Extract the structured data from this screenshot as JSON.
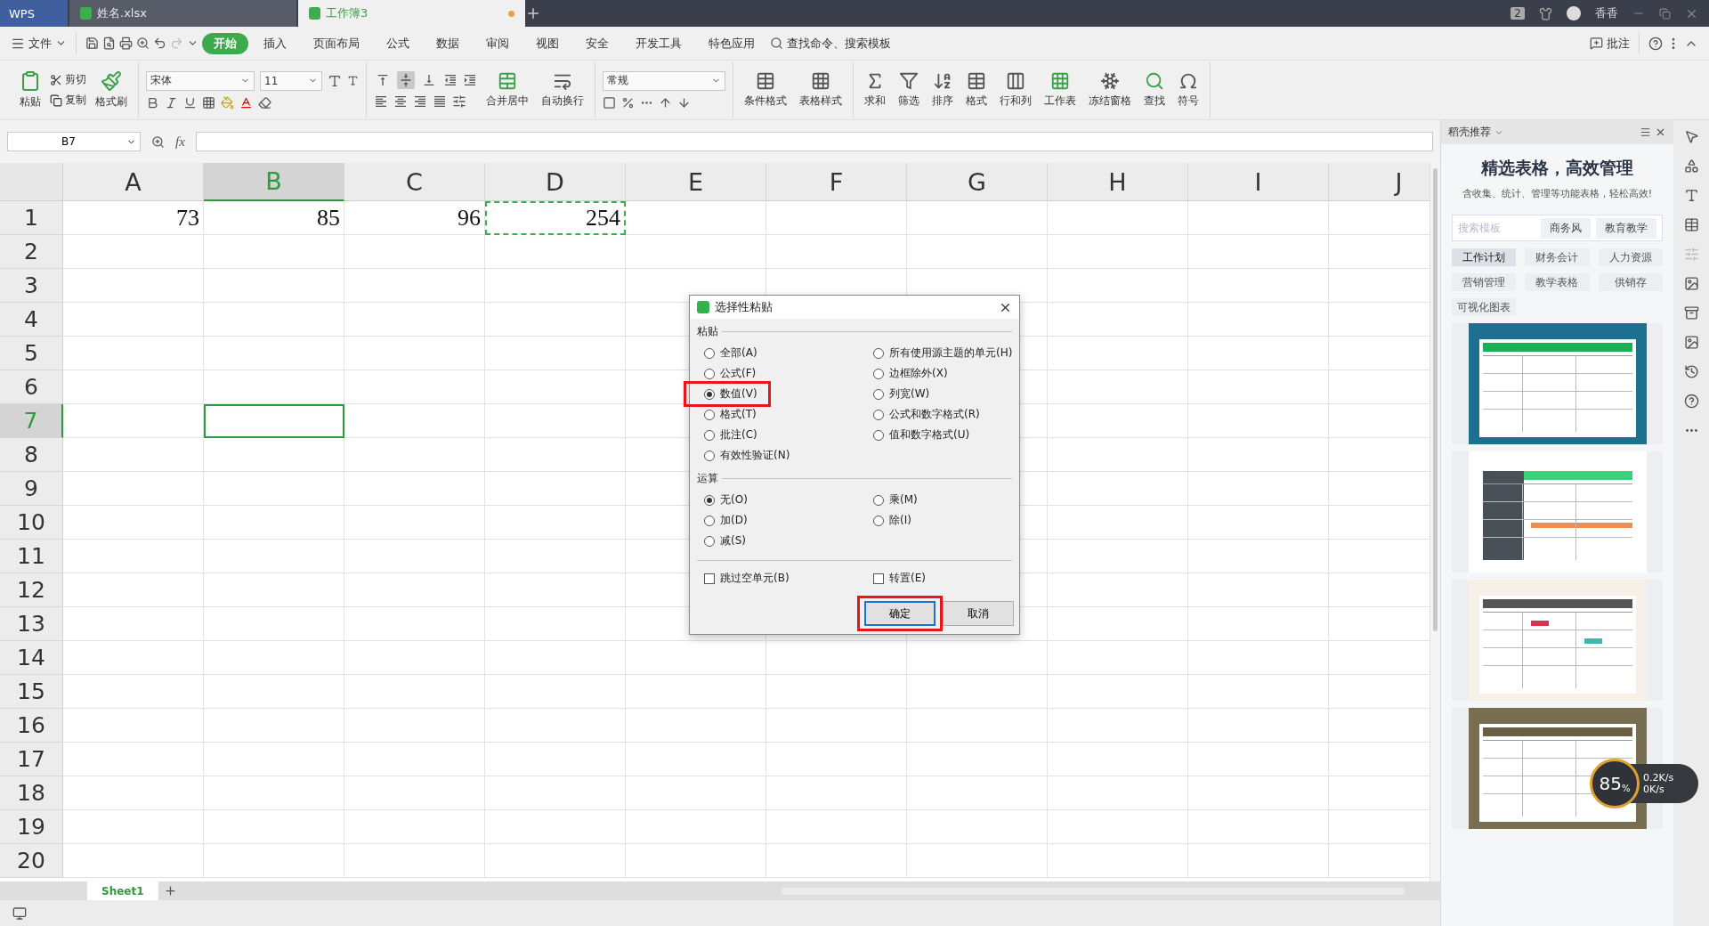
{
  "title_bar": {
    "app_tab": "WPS",
    "tabs": [
      {
        "label": "姓名.xlsx",
        "selected": false
      },
      {
        "label": "工作簿3",
        "selected": true,
        "unsaved": true
      }
    ],
    "badge": "2",
    "user": "香香"
  },
  "menu_bar": {
    "file": "文件",
    "items": [
      {
        "label": "开始",
        "selected": true
      },
      {
        "label": "插入",
        "selected": false
      },
      {
        "label": "页面布局",
        "selected": false
      },
      {
        "label": "公式",
        "selected": false
      },
      {
        "label": "数据",
        "selected": false
      },
      {
        "label": "审阅",
        "selected": false
      },
      {
        "label": "视图",
        "selected": false
      },
      {
        "label": "安全",
        "selected": false
      },
      {
        "label": "开发工具",
        "selected": false
      },
      {
        "label": "特色应用",
        "selected": false
      }
    ],
    "search": "查找命令、搜索模板",
    "comment": "批注"
  },
  "ribbon": {
    "paste": "粘贴",
    "cut": "剪切",
    "copy": "复制",
    "format_painter": "格式刷",
    "font_name": "宋体",
    "font_size": "11",
    "vertical_align": [
      {
        "kind": "top",
        "selected": false
      },
      {
        "kind": "middle",
        "selected": true
      },
      {
        "kind": "bottom",
        "selected": false
      }
    ],
    "merge": "合并居中",
    "wrap": "自动换行",
    "number_format": "常规",
    "tools": [
      {
        "kind": "conditional",
        "label": "条件格式"
      },
      {
        "kind": "table_style",
        "label": "表格样式"
      },
      {
        "kind": "sum",
        "label": "求和"
      },
      {
        "kind": "filter",
        "label": "筛选"
      },
      {
        "kind": "sort",
        "label": "排序"
      },
      {
        "kind": "format",
        "label": "格式"
      },
      {
        "kind": "rows_cols",
        "label": "行和列"
      },
      {
        "kind": "sheet",
        "label": "工作表"
      },
      {
        "kind": "freeze",
        "label": "冻结窗格"
      },
      {
        "kind": "find",
        "label": "查找"
      },
      {
        "kind": "symbol",
        "label": "符号"
      }
    ]
  },
  "formula_bar": {
    "name_box": "B7",
    "fx": "fx"
  },
  "sheet": {
    "columns": [
      {
        "label": "A",
        "selected": false
      },
      {
        "label": "B",
        "selected": true
      },
      {
        "label": "C",
        "selected": false
      },
      {
        "label": "D",
        "selected": false
      },
      {
        "label": "E",
        "selected": false
      },
      {
        "label": "F",
        "selected": false
      },
      {
        "label": "G",
        "selected": false
      },
      {
        "label": "H",
        "selected": false
      },
      {
        "label": "I",
        "selected": false
      },
      {
        "label": "J",
        "selected": false
      }
    ],
    "rows": [
      {
        "label": "1",
        "selected": false,
        "cells": [
          {
            "value": "73",
            "selected": false,
            "copied": false
          },
          {
            "value": "85",
            "selected": false,
            "copied": false
          },
          {
            "value": "96",
            "selected": false,
            "copied": false
          },
          {
            "value": "254",
            "selected": false,
            "copied": true
          }
        ]
      },
      {
        "label": "2",
        "selected": false
      },
      {
        "label": "3",
        "selected": false
      },
      {
        "label": "4",
        "selected": false
      },
      {
        "label": "5",
        "selected": false
      },
      {
        "label": "6",
        "selected": false
      },
      {
        "label": "7",
        "selected": true,
        "cells": [
          {
            "selected": false,
            "copied": false
          },
          {
            "selected": true,
            "copied": false
          }
        ]
      },
      {
        "label": "8",
        "selected": false
      },
      {
        "label": "9",
        "selected": false
      },
      {
        "label": "10",
        "selected": false
      },
      {
        "label": "11",
        "selected": false
      },
      {
        "label": "12",
        "selected": false
      },
      {
        "label": "13",
        "selected": false
      },
      {
        "label": "14",
        "selected": false
      },
      {
        "label": "15",
        "selected": false
      },
      {
        "label": "16",
        "selected": false
      },
      {
        "label": "17",
        "selected": false
      },
      {
        "label": "18",
        "selected": false
      },
      {
        "label": "19",
        "selected": false
      },
      {
        "label": "20",
        "selected": false
      }
    ],
    "tabs": [
      {
        "label": "Sheet1",
        "selected": true
      }
    ]
  },
  "dialog": {
    "title": "选择性粘贴",
    "paste": {
      "label": "粘贴",
      "columns": [
        [
          {
            "label": "全部(A)",
            "selected": false,
            "annotated": false
          },
          {
            "label": "公式(F)",
            "selected": false,
            "annotated": false
          },
          {
            "label": "数值(V)",
            "selected": true,
            "annotated": true
          },
          {
            "label": "格式(T)",
            "selected": false,
            "annotated": false
          },
          {
            "label": "批注(C)",
            "selected": false,
            "annotated": false
          },
          {
            "label": "有效性验证(N)",
            "selected": false,
            "annotated": false
          }
        ],
        [
          {
            "label": "所有使用源主题的单元(H)",
            "selected": false,
            "annotated": false
          },
          {
            "label": "边框除外(X)",
            "selected": false,
            "annotated": false
          },
          {
            "label": "列宽(W)",
            "selected": false,
            "annotated": false
          },
          {
            "label": "公式和数字格式(R)",
            "selected": false,
            "annotated": false
          },
          {
            "label": "值和数字格式(U)",
            "selected": false,
            "annotated": false
          }
        ]
      ]
    },
    "operation": {
      "label": "运算",
      "columns": [
        [
          {
            "label": "无(O)",
            "selected": true,
            "annotated": false
          },
          {
            "label": "加(D)",
            "selected": false,
            "annotated": false
          },
          {
            "label": "减(S)",
            "selected": false,
            "annotated": false
          }
        ],
        [
          {
            "label": "乘(M)",
            "selected": false,
            "annotated": false
          },
          {
            "label": "除(I)",
            "selected": false,
            "annotated": false
          }
        ]
      ]
    },
    "checks": [
      {
        "label": "跳过空单元(B)",
        "checked": false
      },
      {
        "label": "转置(E)",
        "checked": false
      }
    ],
    "buttons": [
      {
        "label": "确定",
        "default": true,
        "annotated": true
      },
      {
        "label": "取消",
        "default": false,
        "annotated": false
      }
    ]
  },
  "side_panel": {
    "title": "稻壳推荐",
    "headline": "精选表格，高效管理",
    "subtitle": "含收集、统计、管理等功能表格，轻松高效!",
    "search_placeholder": "搜索模板",
    "search_chips": [
      "商务风",
      "教育教学"
    ],
    "categories": [
      {
        "label": "工作计划",
        "selected": true
      },
      {
        "label": "财务会计",
        "selected": false
      },
      {
        "label": "人力资源",
        "selected": false
      },
      {
        "label": "营销管理",
        "selected": false
      },
      {
        "label": "教学表格",
        "selected": false
      },
      {
        "label": "供销存",
        "selected": false
      },
      {
        "label": "可视化图表",
        "selected": false
      }
    ],
    "templates": [
      {
        "kind": "picture"
      },
      {
        "kind": "picture"
      },
      {
        "kind": "picture"
      },
      {
        "kind": "picture"
      }
    ]
  },
  "net_monitor": {
    "percent": "85",
    "unit": "%",
    "up": "0.2K/s",
    "down": "0K/s"
  }
}
